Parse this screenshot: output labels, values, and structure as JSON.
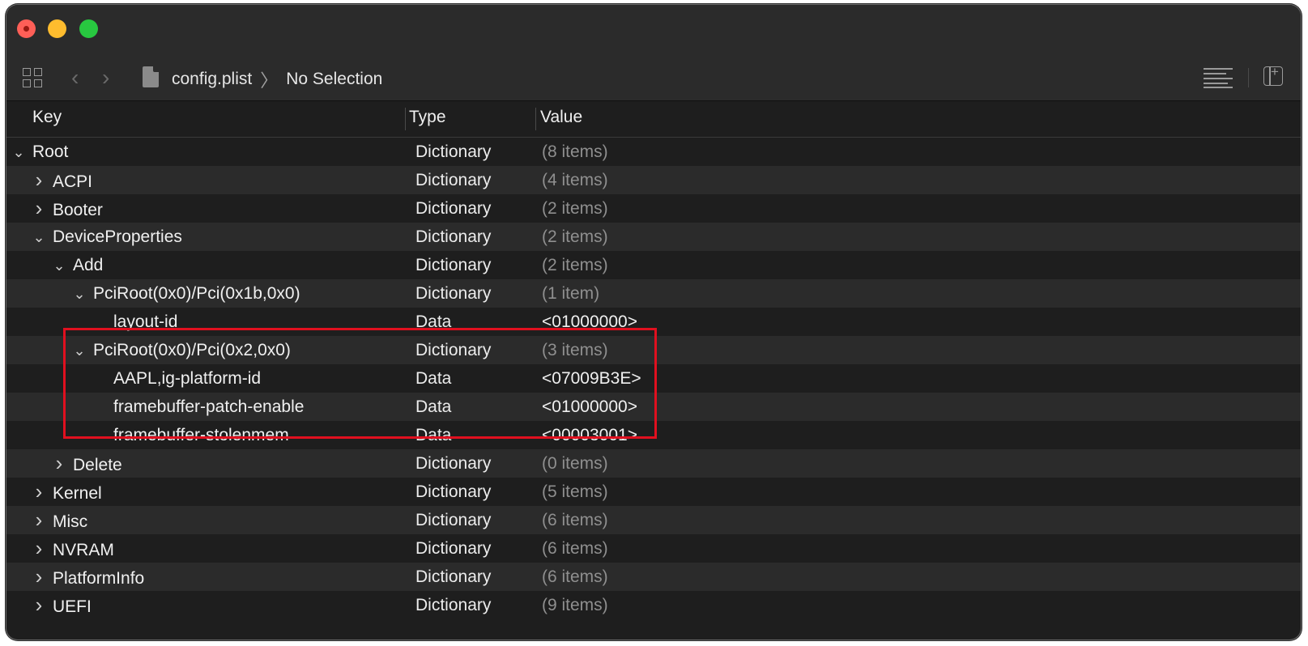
{
  "window": {
    "breadcrumb": [
      "config.plist",
      "No Selection"
    ]
  },
  "icons": {
    "grid": "grid-icon",
    "back": "chevron-left-icon",
    "forward": "chevron-right-icon",
    "file": "file-icon",
    "lines": "text-lines-icon",
    "panel": "sidebar-add-icon"
  },
  "columns": {
    "key": "Key",
    "type": "Type",
    "value": "Value"
  },
  "rows": [
    {
      "key": "Root",
      "type": "Dictionary",
      "value": "(8 items)",
      "level": 0,
      "state": "expanded",
      "muted": true
    },
    {
      "key": "ACPI",
      "type": "Dictionary",
      "value": "(4 items)",
      "level": 1,
      "state": "collapsed",
      "muted": true
    },
    {
      "key": "Booter",
      "type": "Dictionary",
      "value": "(2 items)",
      "level": 1,
      "state": "collapsed",
      "muted": true
    },
    {
      "key": "DeviceProperties",
      "type": "Dictionary",
      "value": "(2 items)",
      "level": 1,
      "state": "expanded",
      "muted": true
    },
    {
      "key": "Add",
      "type": "Dictionary",
      "value": "(2 items)",
      "level": 2,
      "state": "expanded",
      "muted": true
    },
    {
      "key": "PciRoot(0x0)/Pci(0x1b,0x0)",
      "type": "Dictionary",
      "value": "(1 item)",
      "level": 3,
      "state": "expanded",
      "muted": true
    },
    {
      "key": "layout-id",
      "type": "Data",
      "value": "<01000000>",
      "level": 4,
      "state": "leaf",
      "muted": false
    },
    {
      "key": "PciRoot(0x0)/Pci(0x2,0x0)",
      "type": "Dictionary",
      "value": "(3 items)",
      "level": 3,
      "state": "expanded",
      "muted": true
    },
    {
      "key": "AAPL,ig-platform-id",
      "type": "Data",
      "value": "<07009B3E>",
      "level": 4,
      "state": "leaf",
      "muted": false
    },
    {
      "key": "framebuffer-patch-enable",
      "type": "Data",
      "value": "<01000000>",
      "level": 4,
      "state": "leaf",
      "muted": false
    },
    {
      "key": "framebuffer-stolenmem",
      "type": "Data",
      "value": "<00003001>",
      "level": 4,
      "state": "leaf",
      "muted": false
    },
    {
      "key": "Delete",
      "type": "Dictionary",
      "value": "(0 items)",
      "level": 2,
      "state": "collapsed",
      "muted": true
    },
    {
      "key": "Kernel",
      "type": "Dictionary",
      "value": "(5 items)",
      "level": 1,
      "state": "collapsed",
      "muted": true
    },
    {
      "key": "Misc",
      "type": "Dictionary",
      "value": "(6 items)",
      "level": 1,
      "state": "collapsed",
      "muted": true
    },
    {
      "key": "NVRAM",
      "type": "Dictionary",
      "value": "(6 items)",
      "level": 1,
      "state": "collapsed",
      "muted": true
    },
    {
      "key": "PlatformInfo",
      "type": "Dictionary",
      "value": "(6 items)",
      "level": 1,
      "state": "collapsed",
      "muted": true
    },
    {
      "key": "UEFI",
      "type": "Dictionary",
      "value": "(9 items)",
      "level": 1,
      "state": "collapsed",
      "muted": true
    }
  ],
  "colors": {
    "highlight": "#e0101f",
    "muted_value": "#8f8f8f"
  }
}
